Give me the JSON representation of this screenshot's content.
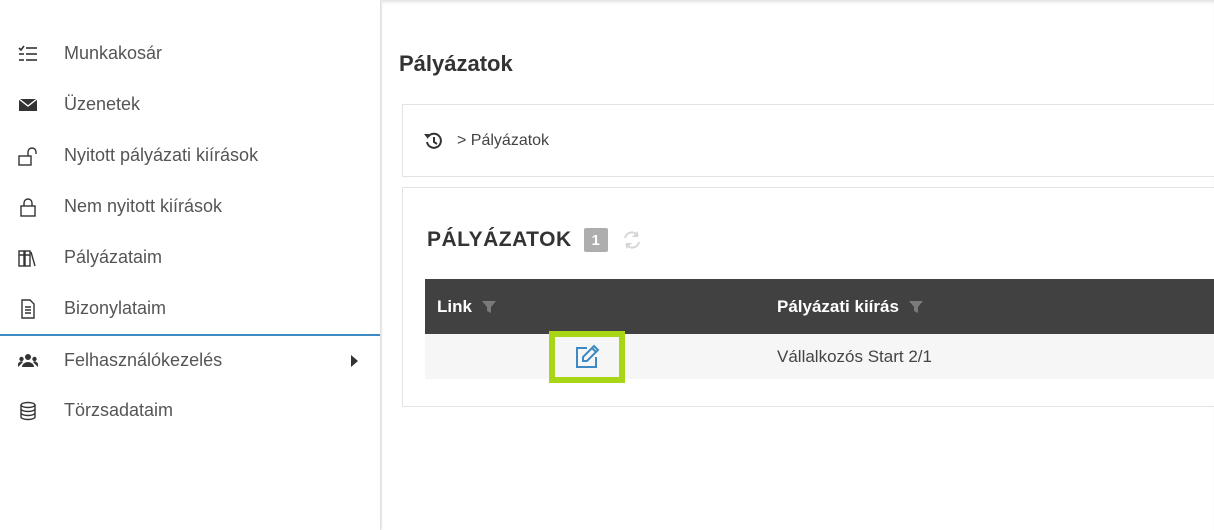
{
  "sidebar": {
    "items": [
      {
        "label": "Munkakosár",
        "icon": "task-list-icon"
      },
      {
        "label": "Üzenetek",
        "icon": "envelope-icon"
      },
      {
        "label": "Nyitott pályázati kiírások",
        "icon": "unlocked-icon"
      },
      {
        "label": "Nem nyitott kiírások",
        "icon": "locked-icon"
      },
      {
        "label": "Pályázataim",
        "icon": "books-icon"
      },
      {
        "label": "Bizonylataim",
        "icon": "document-icon"
      },
      {
        "label": "Felhasználókezelés",
        "icon": "users-icon"
      },
      {
        "label": "Törzsadataim",
        "icon": "database-icon"
      }
    ]
  },
  "main": {
    "title": "Pályázatok",
    "breadcrumb": "> Pályázatok",
    "panel": {
      "title": "PÁLYÁZATOK",
      "count": "1",
      "table": {
        "columns": [
          "Link",
          "Pályázati kiírás"
        ],
        "rows": [
          {
            "link_icon": "edit-icon",
            "kiiras": "Vállalkozós Start 2/1"
          }
        ]
      }
    }
  },
  "colors": {
    "accent_line": "#3d89c4",
    "highlight": "#a9d517",
    "table_header_bg": "#414141",
    "badge_bg": "#aeaeae"
  }
}
